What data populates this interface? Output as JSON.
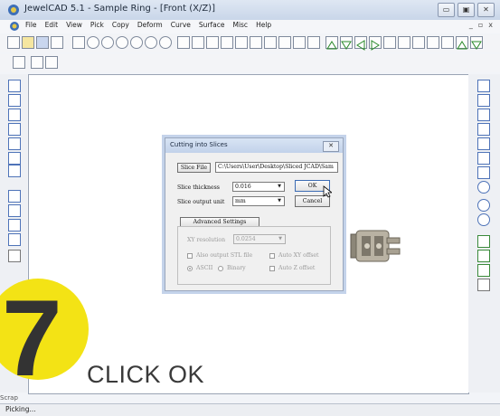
{
  "window": {
    "title": "JewelCAD 5.1 - Sample Ring - [Front (X/Z)]",
    "controls": [
      "▭",
      "▣",
      "✕"
    ]
  },
  "menu": {
    "items": [
      "File",
      "Edit",
      "View",
      "Pick",
      "Copy",
      "Deform",
      "Curve",
      "Surface",
      "Misc",
      "Help"
    ],
    "mdi_controls": [
      "_",
      "▫",
      "x"
    ]
  },
  "dialog": {
    "title": "Cutting into Slices",
    "close_label": "✕",
    "slice_file_button": "Slice File",
    "slice_file_path": "C:\\Users\\User\\Desktop\\Sliced JCAD\\Sam",
    "slice_thickness_label": "Slice thickness",
    "slice_thickness_value": "0.016",
    "slice_output_unit_label": "Slice output unit",
    "slice_output_unit_value": "mm",
    "ok_label": "OK",
    "cancel_label": "Cancel",
    "advanced_settings_label": "Advanced Settings",
    "xy_resolution_label": "XY resolution",
    "xy_resolution_value": "0.0254",
    "also_output_stl_label": "Also output STL file",
    "auto_xy_offset_label": "Auto XY offset",
    "ascii_label": "ASCII",
    "binary_label": "Binary",
    "auto_z_offset_label": "Auto Z offset"
  },
  "status": {
    "text": "Picking...",
    "scrap": "Scrap"
  },
  "overlay": {
    "step_number": "7",
    "caption": "CLICK OK",
    "badge_color": "#f3e315"
  }
}
